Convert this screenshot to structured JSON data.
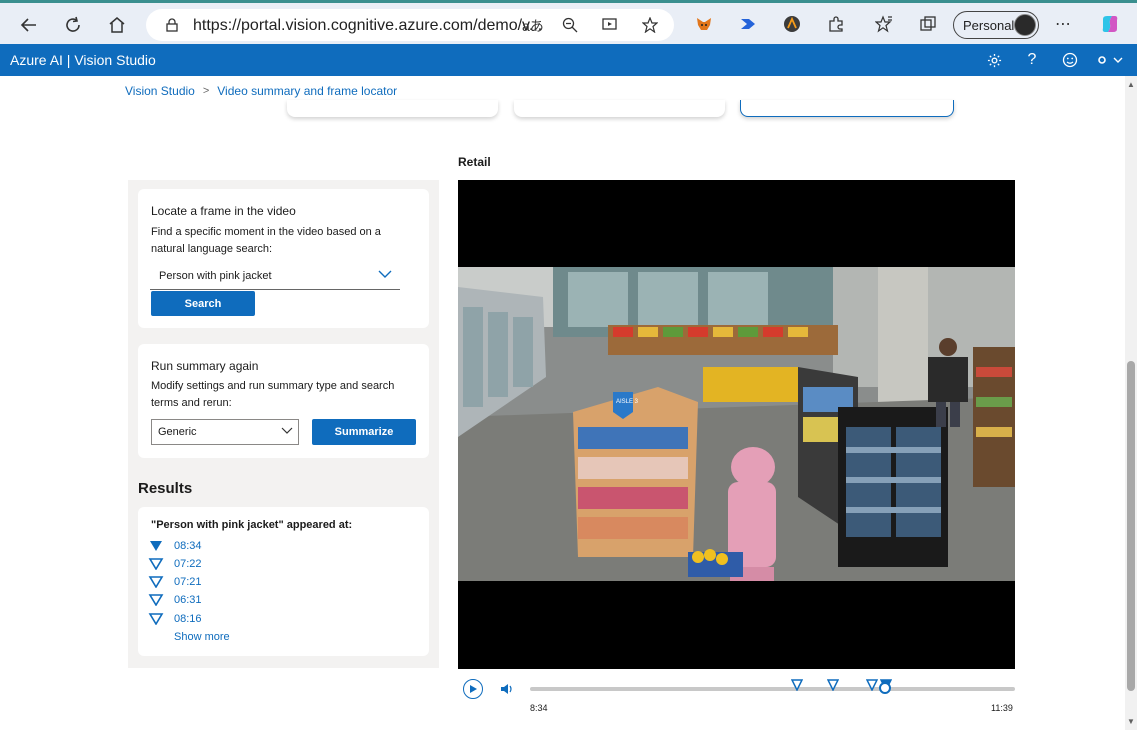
{
  "browser": {
    "url": "https://portal.vision.cognitive.azure.com/demo/v...",
    "profile_label": "Personal"
  },
  "app": {
    "title": "Azure AI  |  Vision Studio"
  },
  "breadcrumb": {
    "items": [
      "Vision Studio",
      "Video summary and frame locator"
    ]
  },
  "locate": {
    "heading": "Locate a frame in the video",
    "description": "Find a specific moment in the video based on a natural language search:",
    "query_value": "Person with pink jacket",
    "search_button": "Search"
  },
  "summary": {
    "heading": "Run summary again",
    "description": "Modify settings and run summary type and search terms and rerun:",
    "type_value": "Generic",
    "summarize_button": "Summarize"
  },
  "results": {
    "title": "Results",
    "query_heading": "\"Person with pink jacket\" appeared at:",
    "times": [
      "08:34",
      "07:22",
      "07:21",
      "06:31",
      "08:16"
    ],
    "show_more": "Show more"
  },
  "video": {
    "title": "Retail",
    "current_time": "8:34",
    "duration": "11:39",
    "progress": 0.7325,
    "markers": [
      0.551,
      0.625,
      0.706,
      0.733
    ],
    "scene_aisle_sign": "AISLE 3"
  },
  "colors": {
    "brand": "#0f6cbd",
    "panel_bg": "#f3f2f1"
  }
}
